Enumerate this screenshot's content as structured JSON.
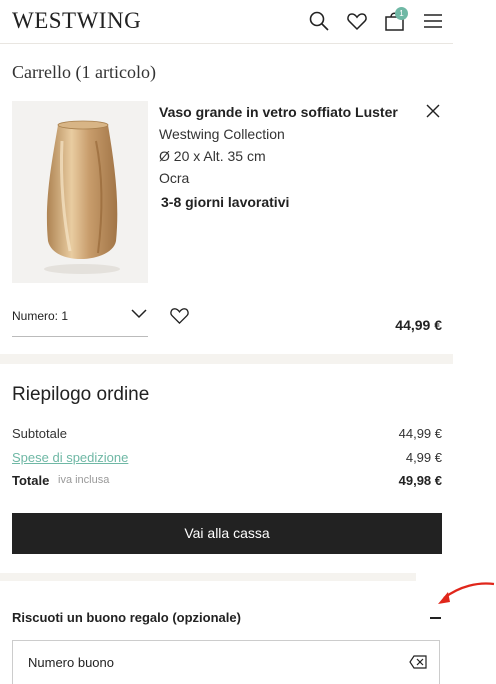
{
  "header": {
    "logo": "WESTWING",
    "cart_count": "1",
    "icons": [
      "search-icon",
      "heart-icon",
      "bag-icon",
      "menu-icon"
    ]
  },
  "cart": {
    "title": "Carrello (1 articolo)",
    "item": {
      "name": "Vaso grande in vetro soffiato Luster",
      "brand": "Westwing Collection",
      "dimensions": "Ø 20 x Alt. 35 cm",
      "color": "Ocra",
      "delivery": "3-8 giorni lavorativi",
      "quantity_label": "Numero: 1",
      "price": "44,99 €"
    }
  },
  "summary": {
    "title": "Riepilogo ordine",
    "subtotal_label": "Subtotale",
    "subtotal_value": "44,99 €",
    "shipping_label": "Spese di spedizione",
    "shipping_value": "4,99 €",
    "total_label": "Totale",
    "total_note": "iva inclusa",
    "total_value": "49,98 €",
    "checkout_label": "Vai alla cassa"
  },
  "voucher": {
    "title": "Riscuoti un buono regalo (opzionale)",
    "placeholder": "Numero buono"
  },
  "colors": {
    "accent": "#6fb8a5",
    "button": "#222222",
    "annotation_arrow": "#e0261b"
  }
}
